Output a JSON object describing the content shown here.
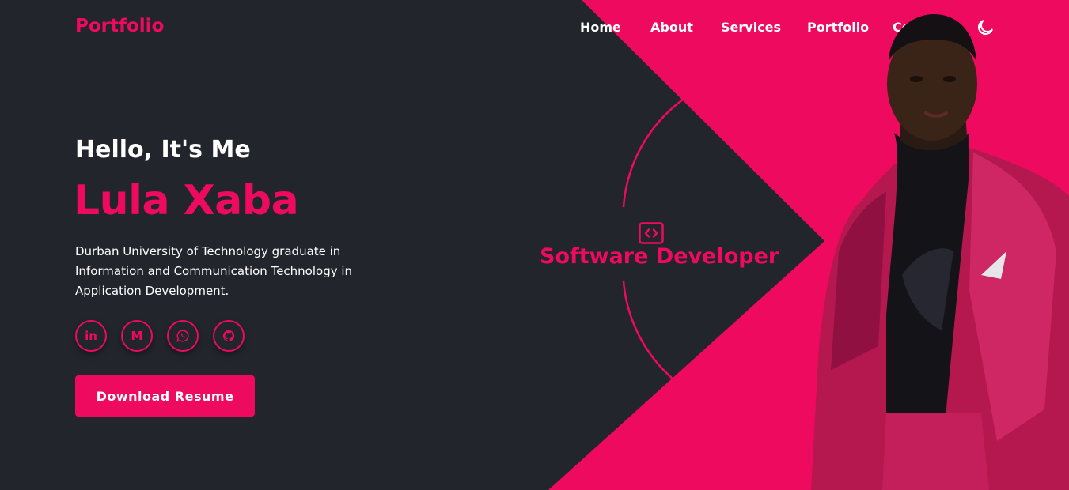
{
  "brand": {
    "logo": "Portfolio"
  },
  "nav": {
    "items": [
      {
        "label": "Home"
      },
      {
        "label": "About"
      },
      {
        "label": "Services"
      },
      {
        "label": "Portfolio"
      },
      {
        "label": "Contact"
      }
    ],
    "theme_toggle_icon": "moon-icon"
  },
  "hero": {
    "greeting": "Hello, It's Me",
    "name": "Lula Xaba",
    "bio": "Durban University of Technology graduate in Information and Communication Technology in Application Development.",
    "socials": [
      {
        "icon": "linkedin-icon",
        "glyph": "in"
      },
      {
        "icon": "gmail-icon",
        "glyph": "M"
      },
      {
        "icon": "whatsapp-icon"
      },
      {
        "icon": "github-icon"
      }
    ],
    "download_label": "Download Resume",
    "role_icon": "code-icon",
    "role": "Software Developer"
  },
  "colors": {
    "background": "#23252d",
    "accent": "#ee0a5e",
    "text": "#ffffff"
  }
}
